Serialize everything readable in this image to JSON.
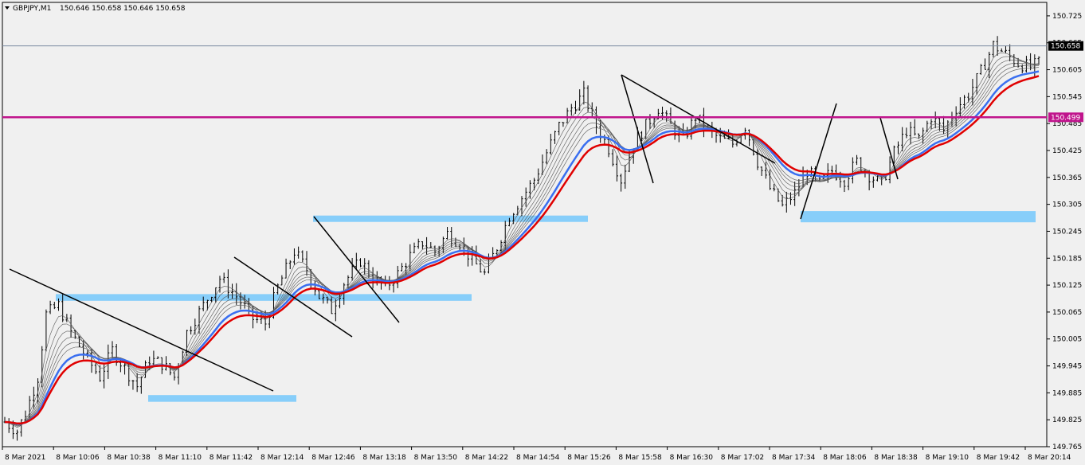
{
  "header": {
    "symbol": "GBPJPY,M1",
    "ohlc": "150.646 150.658 150.646 150.658"
  },
  "chart_data": {
    "type": "candlestick",
    "symbol": "GBPJPY",
    "timeframe": "M1",
    "ylim": [
      149.765,
      150.755
    ],
    "y_ticks": [
      "150.725",
      "150.665",
      "150.605",
      "150.545",
      "150.485",
      "150.425",
      "150.365",
      "150.305",
      "150.245",
      "150.185",
      "150.125",
      "150.065",
      "150.005",
      "149.945",
      "149.885",
      "149.825",
      "149.765"
    ],
    "x_ticks": [
      "8 Mar 2021",
      "8 Mar 10:06",
      "8 Mar 10:38",
      "8 Mar 11:10",
      "8 Mar 11:42",
      "8 Mar 12:14",
      "8 Mar 12:46",
      "8 Mar 13:18",
      "8 Mar 13:50",
      "8 Mar 14:22",
      "8 Mar 14:54",
      "8 Mar 15:26",
      "8 Mar 15:58",
      "8 Mar 16:30",
      "8 Mar 17:02",
      "8 Mar 17:34",
      "8 Mar 18:06",
      "8 Mar 18:38",
      "8 Mar 19:10",
      "8 Mar 19:42",
      "8 Mar 20:14"
    ],
    "last_price": "150.658",
    "horizontal_line_price": "150.499",
    "close_path": [
      [
        0,
        149.82
      ],
      [
        3,
        149.8
      ],
      [
        5,
        149.84
      ],
      [
        8,
        149.92
      ],
      [
        10,
        150.06
      ],
      [
        13,
        150.08
      ],
      [
        16,
        150.02
      ],
      [
        20,
        149.96
      ],
      [
        23,
        149.92
      ],
      [
        26,
        149.98
      ],
      [
        29,
        149.94
      ],
      [
        32,
        149.9
      ],
      [
        35,
        149.96
      ],
      [
        38,
        149.95
      ],
      [
        41,
        149.92
      ],
      [
        44,
        150.02
      ],
      [
        48,
        150.08
      ],
      [
        52,
        150.14
      ],
      [
        56,
        150.1
      ],
      [
        60,
        150.05
      ],
      [
        63,
        150.04
      ],
      [
        66,
        150.12
      ],
      [
        70,
        150.2
      ],
      [
        73,
        150.16
      ],
      [
        76,
        150.1
      ],
      [
        79,
        150.07
      ],
      [
        82,
        150.13
      ],
      [
        86,
        150.18
      ],
      [
        89,
        150.14
      ],
      [
        92,
        150.12
      ],
      [
        95,
        150.15
      ],
      [
        98,
        150.19
      ],
      [
        101,
        150.22
      ],
      [
        104,
        150.2
      ],
      [
        107,
        150.24
      ],
      [
        110,
        150.22
      ],
      [
        113,
        150.18
      ],
      [
        116,
        150.15
      ],
      [
        119,
        150.21
      ],
      [
        122,
        150.28
      ],
      [
        125,
        150.32
      ],
      [
        128,
        150.36
      ],
      [
        131,
        150.42
      ],
      [
        134,
        150.48
      ],
      [
        137,
        150.52
      ],
      [
        140,
        150.55
      ],
      [
        143,
        150.48
      ],
      [
        146,
        150.43
      ],
      [
        149,
        150.36
      ],
      [
        152,
        150.44
      ],
      [
        155,
        150.48
      ],
      [
        158,
        150.52
      ],
      [
        161,
        150.48
      ],
      [
        164,
        150.45
      ],
      [
        167,
        150.5
      ],
      [
        170,
        150.47
      ],
      [
        173,
        150.45
      ],
      [
        176,
        150.44
      ],
      [
        179,
        150.48
      ],
      [
        182,
        150.4
      ],
      [
        185,
        150.34
      ],
      [
        188,
        150.3
      ],
      [
        191,
        150.33
      ],
      [
        194,
        150.38
      ],
      [
        197,
        150.35
      ],
      [
        200,
        150.38
      ],
      [
        203,
        150.36
      ],
      [
        206,
        150.4
      ],
      [
        209,
        150.37
      ],
      [
        212,
        150.35
      ],
      [
        215,
        150.42
      ],
      [
        218,
        150.47
      ],
      [
        221,
        150.45
      ],
      [
        224,
        150.5
      ],
      [
        227,
        150.47
      ],
      [
        230,
        150.52
      ],
      [
        233,
        150.55
      ],
      [
        236,
        150.6
      ],
      [
        239,
        150.66
      ],
      [
        242,
        150.64
      ],
      [
        245,
        150.62
      ],
      [
        248,
        150.61
      ],
      [
        250,
        150.62
      ]
    ],
    "series": [
      {
        "name": "moving average (red)",
        "color": "#e00000"
      },
      {
        "name": "moving average (blue)",
        "color": "#3a6ff0"
      }
    ],
    "zones": [
      {
        "price_low": 149.865,
        "price_high": 149.88,
        "color": "#87cefa"
      },
      {
        "price_low": 150.09,
        "price_high": 150.105,
        "color": "#87cefa"
      },
      {
        "price_low": 150.27,
        "price_high": 150.28,
        "color": "#87cefa"
      },
      {
        "price_low": 150.265,
        "price_high": 150.29,
        "color": "#87cefa"
      }
    ]
  },
  "colors": {
    "background": "#f0f0f0",
    "candle": "#000000",
    "ma_red": "#e00000",
    "ma_blue": "#3a6ff0",
    "level_line": "#c0148c",
    "zone": "#87cefa",
    "last_price_line": "#7a8aa0"
  }
}
